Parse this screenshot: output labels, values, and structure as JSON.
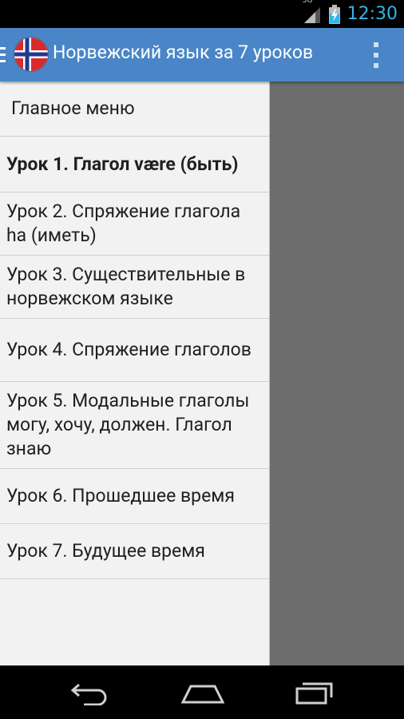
{
  "status_bar": {
    "network_type": "3G",
    "time": "12:30",
    "icons": [
      "signal-icon",
      "battery-charging-icon"
    ]
  },
  "action_bar": {
    "title": "Норвежский язык за 7 уроков",
    "logo_icon": "norway-flag-icon",
    "menu_icon": "overflow-menu-icon",
    "colors": {
      "background": "#4a86c7"
    }
  },
  "drawer": {
    "header": "Главное меню",
    "items": [
      {
        "label": "Урок 1. Глагол være (быть)",
        "active": true
      },
      {
        "label": "Урок 2. Спряжение глагола ha (иметь)",
        "active": false
      },
      {
        "label": "Урок 3. Существительные в норвежском языке",
        "active": false
      },
      {
        "label": "Урок 4. Спряжение глаголов",
        "active": false
      },
      {
        "label": "Урок 5. Модальные глаголы могу, хочу, должен. Глагол знаю",
        "active": false
      },
      {
        "label": "Урок 6. Прошедшее время",
        "active": false
      },
      {
        "label": "Урок 7. Будущее время",
        "active": false
      }
    ]
  },
  "nav_bar": {
    "buttons": [
      "back-icon",
      "home-icon",
      "recent-apps-icon"
    ]
  }
}
